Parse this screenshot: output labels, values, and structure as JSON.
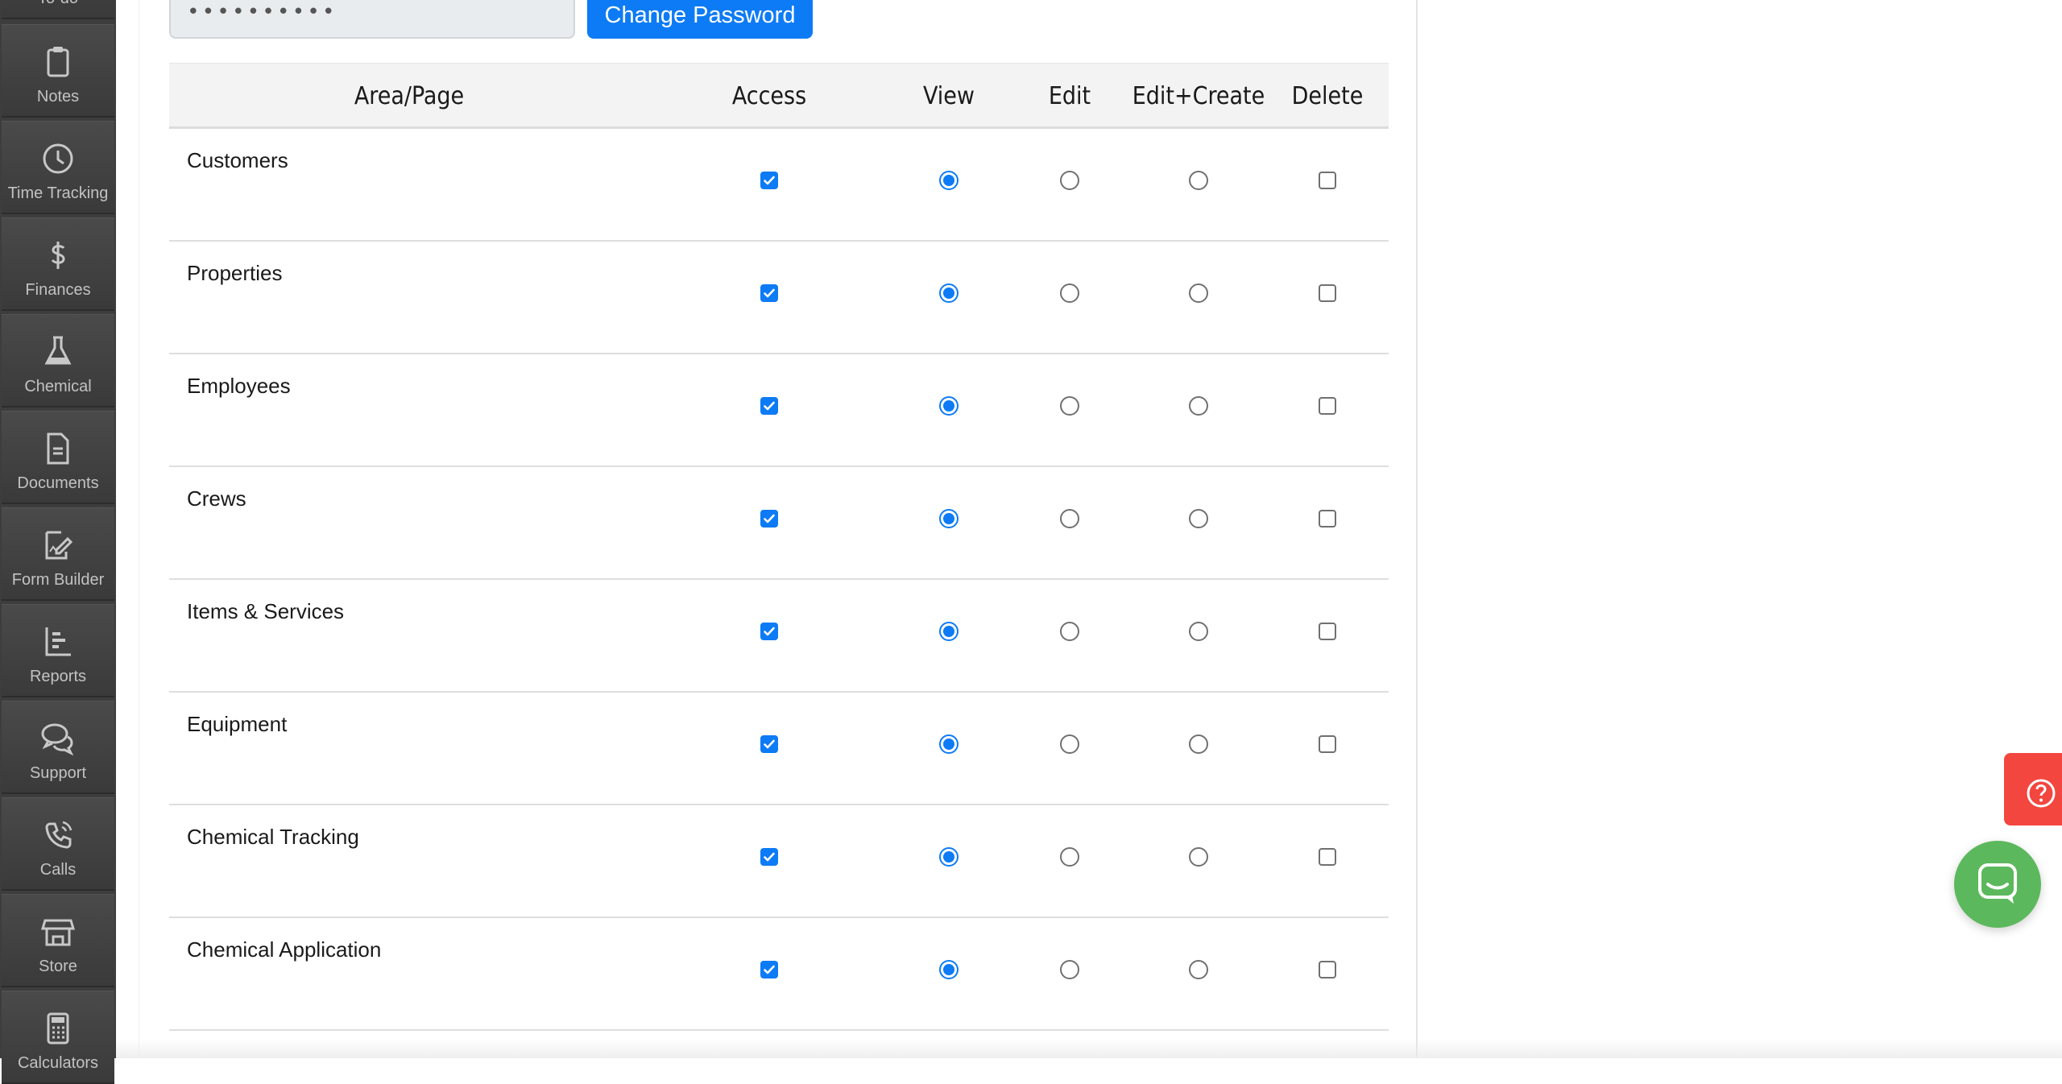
{
  "sidebar": {
    "items": [
      {
        "label": "To-do",
        "icon": "todo-icon"
      },
      {
        "label": "Notes",
        "icon": "clipboard-icon"
      },
      {
        "label": "Time Tracking",
        "icon": "clock-icon"
      },
      {
        "label": "Finances",
        "icon": "dollar-icon"
      },
      {
        "label": "Chemical",
        "icon": "flask-icon"
      },
      {
        "label": "Documents",
        "icon": "document-icon"
      },
      {
        "label": "Form Builder",
        "icon": "form-builder-icon"
      },
      {
        "label": "Reports",
        "icon": "bar-chart-icon"
      },
      {
        "label": "Support",
        "icon": "chat-bubbles-icon"
      },
      {
        "label": "Calls",
        "icon": "phone-icon"
      },
      {
        "label": "Store",
        "icon": "storefront-icon"
      },
      {
        "label": "Calculators",
        "icon": "calculator-icon"
      }
    ]
  },
  "password": {
    "masked_value": "••••••••••",
    "change_button": "Change Password"
  },
  "permissions": {
    "headers": {
      "area": "Area/Page",
      "access": "Access",
      "view": "View",
      "edit": "Edit",
      "edit_create": "Edit+Create",
      "delete": "Delete"
    },
    "rows": [
      {
        "area": "Customers",
        "access": true,
        "level": "view",
        "delete": false
      },
      {
        "area": "Properties",
        "access": true,
        "level": "view",
        "delete": false
      },
      {
        "area": "Employees",
        "access": true,
        "level": "view",
        "delete": false
      },
      {
        "area": "Crews",
        "access": true,
        "level": "view",
        "delete": false
      },
      {
        "area": "Items & Services",
        "access": true,
        "level": "view",
        "delete": false
      },
      {
        "area": "Equipment",
        "access": true,
        "level": "view",
        "delete": false
      },
      {
        "area": "Chemical Tracking",
        "access": true,
        "level": "view",
        "delete": false
      },
      {
        "area": "Chemical Application",
        "access": true,
        "level": "view",
        "delete": false
      }
    ]
  },
  "colors": {
    "accent": "#0d7bf5",
    "sidebar_bg": "#3d3d3d",
    "help_tab": "#f2463f",
    "chat_bubble": "#5cb85c"
  }
}
